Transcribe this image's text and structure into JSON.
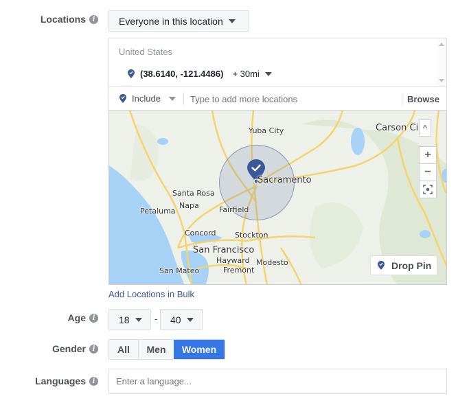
{
  "locations": {
    "label": "Locations",
    "info_icon": "info-icon",
    "audience_select": "Everyone in this location",
    "country": "United States",
    "selected_location": {
      "coordinates": "(38.6140, -121.4486)",
      "radius": "+ 30mi"
    },
    "include_select": "Include",
    "search_placeholder": "Type to add more locations",
    "browse_label": "Browse",
    "add_bulk_link": "Add Locations in Bulk"
  },
  "map": {
    "places": [
      "Yuba City",
      "Carson Ci",
      "Sacramento",
      "Santa Rosa",
      "Napa",
      "Petaluma",
      "Fairfield",
      "Concord",
      "Stockton",
      "San Francisco",
      "Hayward",
      "Modesto",
      "San Mateo",
      "Fremont"
    ],
    "zoom_in": "+",
    "zoom_out": "−",
    "collapse": "^",
    "drop_pin_label": "Drop Pin",
    "accent_color": "#3b5998"
  },
  "age": {
    "label": "Age",
    "min": "18",
    "separator": "-",
    "max": "40"
  },
  "gender": {
    "label": "Gender",
    "options": [
      "All",
      "Men",
      "Women"
    ],
    "selected": "Women",
    "selected_color": "#4080ff"
  },
  "languages": {
    "label": "Languages",
    "placeholder": "Enter a language..."
  }
}
